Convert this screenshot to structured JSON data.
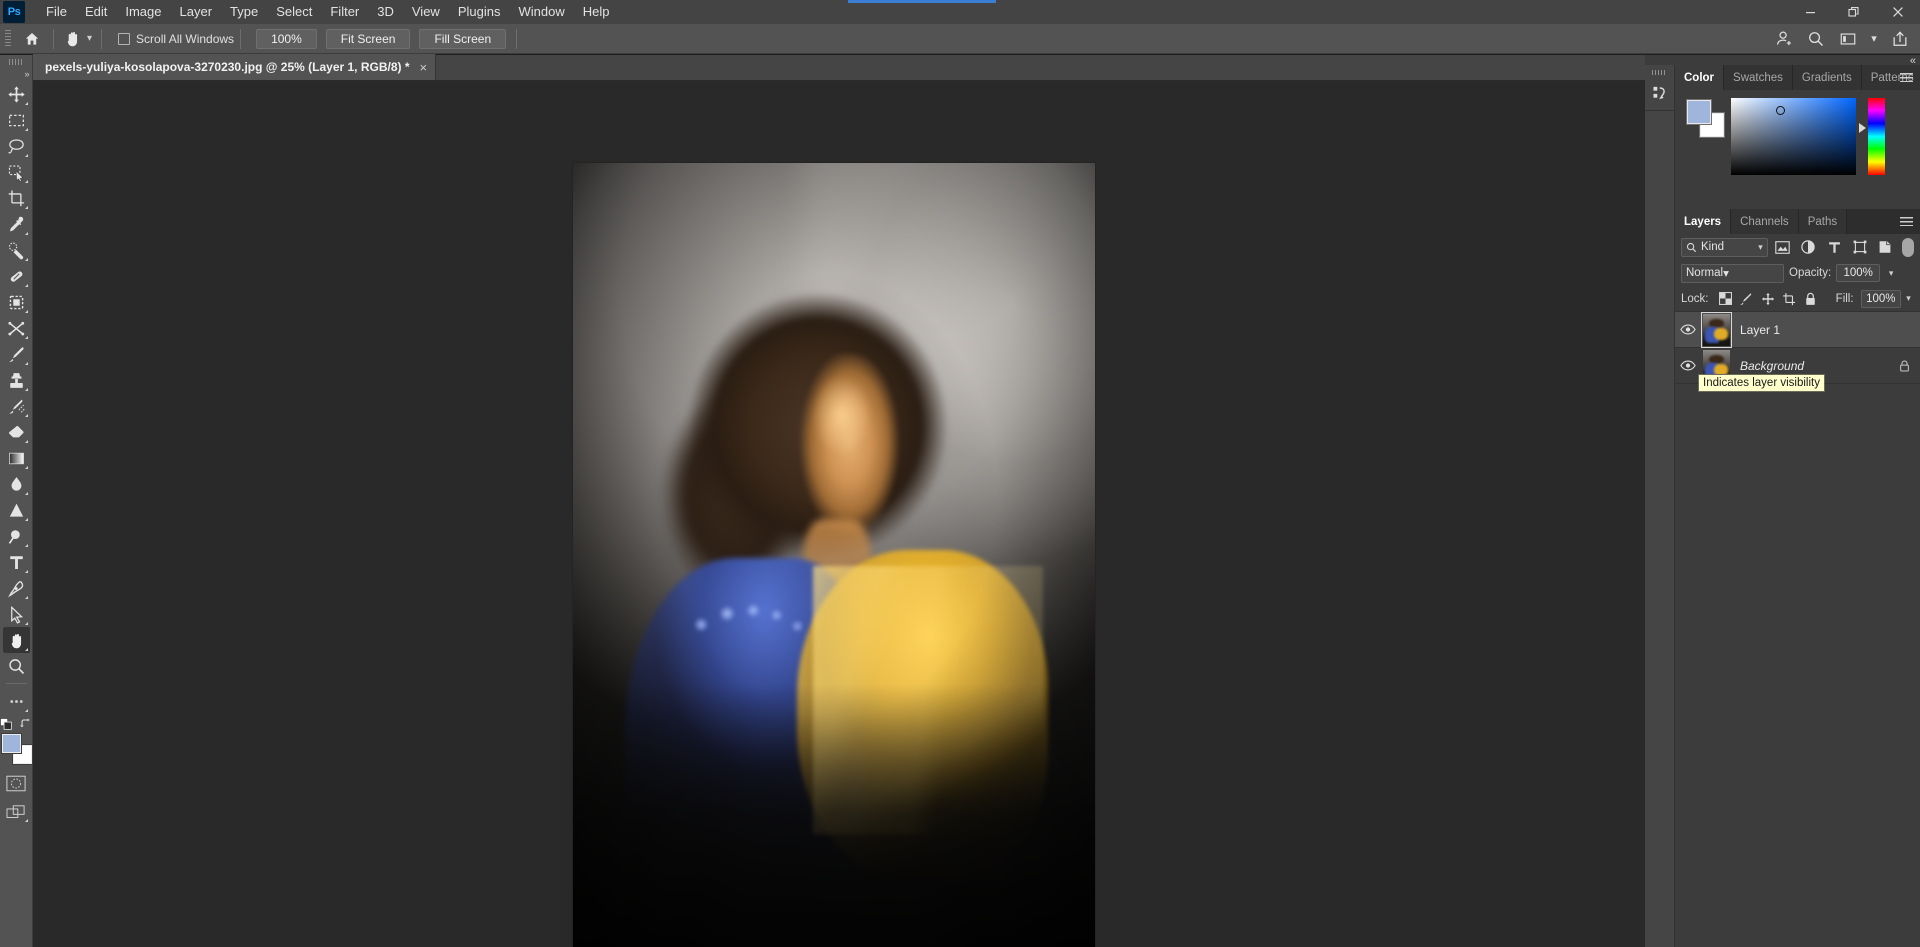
{
  "app": {
    "name": "Adobe Photoshop",
    "logo_text": "Ps"
  },
  "menubar": {
    "items": [
      "File",
      "Edit",
      "Image",
      "Layer",
      "Type",
      "Select",
      "Filter",
      "3D",
      "View",
      "Plugins",
      "Window",
      "Help"
    ]
  },
  "window_controls": {
    "minimize": "minimize-icon",
    "restore": "restore-icon",
    "close": "close-icon"
  },
  "options_bar": {
    "home_icon": "home-icon",
    "active_tool_icon": "hand-tool-icon",
    "preset_chevron": "chevron-down-icon",
    "scroll_all_windows": {
      "label": "Scroll All Windows",
      "checked": false
    },
    "buttons": [
      {
        "label": "100%",
        "name": "zoom-100-button"
      },
      {
        "label": "Fit Screen",
        "name": "fit-screen-button"
      },
      {
        "label": "Fill Screen",
        "name": "fill-screen-button"
      }
    ],
    "right_icons": [
      "share-user-icon",
      "search-icon",
      "workspace-icon",
      "chevron-down-icon",
      "export-icon"
    ]
  },
  "toolbar": {
    "tools": [
      {
        "name": "move-tool",
        "icon": "move-icon",
        "active": false
      },
      {
        "name": "marquee-tool",
        "icon": "rectangular-marquee-icon",
        "active": false
      },
      {
        "name": "lasso-tool",
        "icon": "lasso-icon",
        "active": false
      },
      {
        "name": "object-selection-tool",
        "icon": "object-selection-icon",
        "active": false
      },
      {
        "name": "crop-tool",
        "icon": "crop-icon",
        "active": false
      },
      {
        "name": "eyedropper-tool",
        "icon": "eyedropper-icon",
        "active": false
      },
      {
        "name": "spot-healing-brush-tool",
        "icon": "spot-healing-icon",
        "active": false
      },
      {
        "name": "patch-tool",
        "icon": "patch-icon",
        "active": false
      },
      {
        "name": "frame-tool",
        "icon": "frame-icon",
        "active": false
      },
      {
        "name": "transform-tool",
        "icon": "shuffle-icon",
        "active": false
      },
      {
        "name": "brush-tool",
        "icon": "brush-icon",
        "active": false
      },
      {
        "name": "clone-stamp-tool",
        "icon": "clone-stamp-icon",
        "active": false
      },
      {
        "name": "history-brush-tool",
        "icon": "history-brush-icon",
        "active": false
      },
      {
        "name": "eraser-tool",
        "icon": "eraser-icon",
        "active": false
      },
      {
        "name": "gradient-tool",
        "icon": "gradient-icon",
        "active": false
      },
      {
        "name": "blur-tool",
        "icon": "blur-drop-icon",
        "active": false
      },
      {
        "name": "dodge-tool",
        "icon": "dodge-icon",
        "active": false
      },
      {
        "name": "path-selection-tool",
        "icon": "magnifier-path-icon",
        "active": false
      },
      {
        "name": "type-tool",
        "icon": "type-t-icon",
        "active": false
      },
      {
        "name": "pen-tool",
        "icon": "pen-icon",
        "active": false
      },
      {
        "name": "direct-selection-tool",
        "icon": "arrow-cursor-icon",
        "active": false
      },
      {
        "name": "hand-tool",
        "icon": "hand-icon",
        "active": true
      },
      {
        "name": "zoom-tool",
        "icon": "magnifier-icon",
        "active": false
      },
      {
        "name": "edit-toolbar",
        "icon": "ellipsis-icon",
        "active": false
      }
    ],
    "default_colors_icon": "default-colors-icon",
    "swap_colors_icon": "swap-colors-icon",
    "foreground_color": "#9fb5dc",
    "background_color": "#ffffff",
    "quick_mask_icon": "quick-mask-icon",
    "screen_mode_icon": "screen-mode-icon"
  },
  "document": {
    "tab_title": "pexels-yuliya-kosolapova-3270230.jpg @ 25% (Layer 1, RGB/8) *",
    "close_glyph": "×",
    "zoom_level": "25%",
    "color_mode": "RGB/8",
    "active_layer": "Layer 1",
    "modified": true,
    "image_description": "Portrait of a woman with dark curly hair lit warmly on the face, wearing a blue-lit embroidered gown with golden yellow tulle fabric"
  },
  "panels": {
    "collapse_icon": "double-chevron-left-icon",
    "mini_dock": [
      {
        "name": "history-panel-icon",
        "icon": "history-icon"
      }
    ],
    "color_group": {
      "tabs": [
        {
          "label": "Color",
          "active": true
        },
        {
          "label": "Swatches",
          "active": false
        },
        {
          "label": "Gradients",
          "active": false
        },
        {
          "label": "Patterns",
          "active": false
        }
      ],
      "menu_icon": "panel-menu-icon",
      "foreground_color": "#9fb5dc",
      "background_color": "#ffffff",
      "picker_marker": "color-picker-ring",
      "hue_marker": "hue-slider-marker"
    },
    "layers_group": {
      "tabs": [
        {
          "label": "Layers",
          "active": true
        },
        {
          "label": "Channels",
          "active": false
        },
        {
          "label": "Paths",
          "active": false
        }
      ],
      "menu_icon": "panel-menu-icon",
      "filter": {
        "search_icon": "search-icon",
        "kind_label": "Kind",
        "chevron": "chevron-down-icon",
        "type_icons": [
          "pixel-filter-icon",
          "adjustment-filter-icon",
          "type-filter-icon",
          "shape-filter-icon",
          "smart-object-filter-icon"
        ],
        "toggle": "filter-toggle-switch"
      },
      "blend_mode": "Normal",
      "opacity_label": "Opacity:",
      "opacity_value": "100%",
      "lock_label": "Lock:",
      "lock_icons": [
        "lock-transparent-pixels-icon",
        "lock-image-pixels-icon",
        "lock-position-icon",
        "lock-artboard-icon",
        "lock-all-icon"
      ],
      "fill_label": "Fill:",
      "fill_value": "100%",
      "layers": [
        {
          "name": "Layer 1",
          "visible": true,
          "selected": true,
          "locked": false,
          "italic": false
        },
        {
          "name": "Background",
          "visible": true,
          "selected": false,
          "locked": true,
          "italic": true
        }
      ]
    }
  },
  "tooltip": {
    "text": "Indicates layer visibility",
    "visible": true
  }
}
